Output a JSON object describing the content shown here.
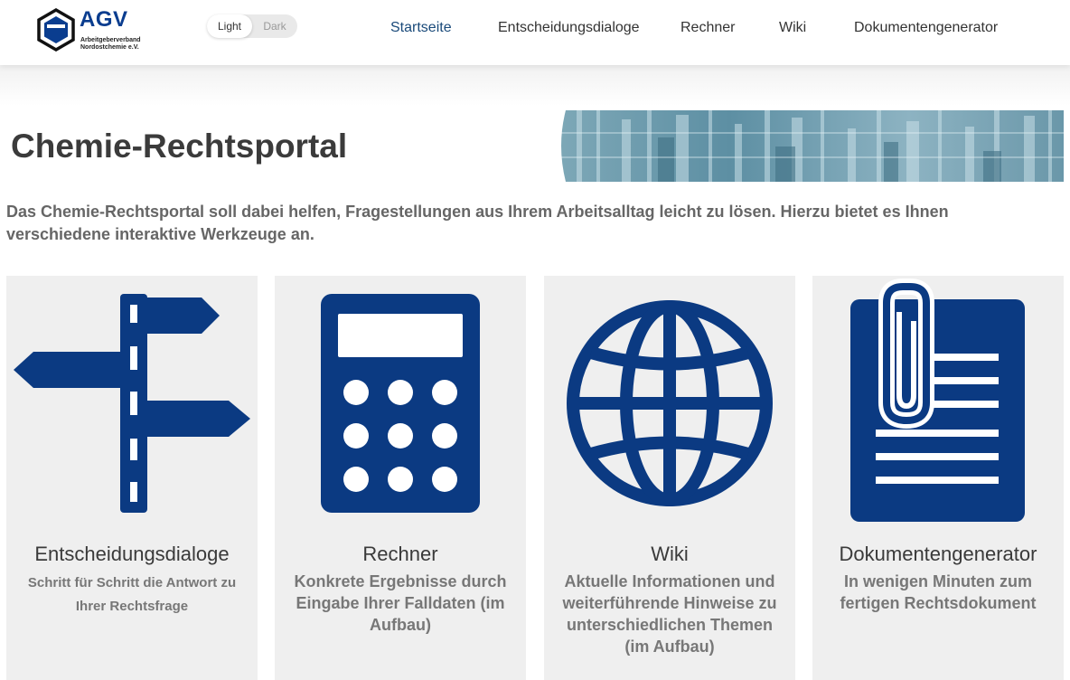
{
  "header": {
    "logo": {
      "abbr": "AGV",
      "line1": "Arbeitgeberverband",
      "line2": "Nordostchemie e.V."
    },
    "theme_toggle": {
      "light": "Light",
      "dark": "Dark",
      "selected": "Light"
    },
    "nav": [
      {
        "label": "Startseite",
        "active": true
      },
      {
        "label": "Entscheidungsdialoge",
        "active": false
      },
      {
        "label": "Rechner",
        "active": false
      },
      {
        "label": "Wiki",
        "active": false
      },
      {
        "label": "Dokumentengenerator",
        "active": false
      }
    ]
  },
  "hero": {
    "title": "Chemie-Rechtsportal",
    "intro": "Das Chemie-Rechtsportal soll dabei helfen, Fragestellungen aus Ihrem Arbeitsalltag leicht zu lösen. Hierzu bietet es Ihnen verschiedene interaktive Werkzeuge an."
  },
  "cards": [
    {
      "icon": "signpost-icon",
      "title": "Entscheidungsdialoge",
      "description": "Schritt für Schritt die Antwort zu Ihrer Rechtsfrage"
    },
    {
      "icon": "calculator-icon",
      "title": "Rechner",
      "description": "Konkrete Ergebnisse durch Eingabe Ihrer Falldaten (im Aufbau)"
    },
    {
      "icon": "globe-icon",
      "title": "Wiki",
      "description": "Aktuelle Informationen und weiterführende Hinweise zu unterschiedlichen Themen (im Aufbau)"
    },
    {
      "icon": "document-clip-icon",
      "title": "Dokumentengenerator",
      "description": "In wenigen Minuten zum fertigen Rechtsdokument"
    }
  ],
  "colors": {
    "icon_blue": "#0b3a82",
    "card_bg": "#efefef",
    "nav_active": "#1a4a7a",
    "logo_blue": "#0a3d8f"
  }
}
